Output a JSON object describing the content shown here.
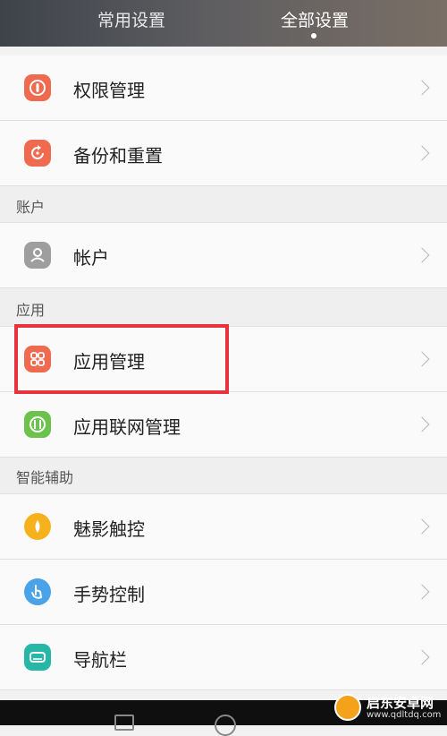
{
  "tabs": {
    "common": "常用设置",
    "all": "全部设置"
  },
  "rows": [
    {
      "label": "权限管理",
      "icon": "permission-icon",
      "color": "#ef6a4f"
    },
    {
      "label": "备份和重置",
      "icon": "backup-reset-icon",
      "color": "#ef6a4f"
    },
    {
      "label": "帐户",
      "icon": "account-icon",
      "color": "#9e9e9e"
    },
    {
      "label": "应用管理",
      "icon": "app-manager-icon",
      "color": "#ef6a4f"
    },
    {
      "label": "应用联网管理",
      "icon": "network-manager-icon",
      "color": "#6cc24a"
    },
    {
      "label": "魅影触控",
      "icon": "phantom-touch-icon",
      "color": "#f6b21c"
    },
    {
      "label": "手势控制",
      "icon": "gesture-icon",
      "color": "#4aa3e8"
    },
    {
      "label": "导航栏",
      "icon": "navigation-bar-icon",
      "color": "#26b7a8"
    }
  ],
  "sections": {
    "account": "账户",
    "apps": "应用",
    "assist": "智能辅助"
  },
  "watermark": {
    "title": "启东安卓网",
    "url": "www.qdltdq.com"
  }
}
